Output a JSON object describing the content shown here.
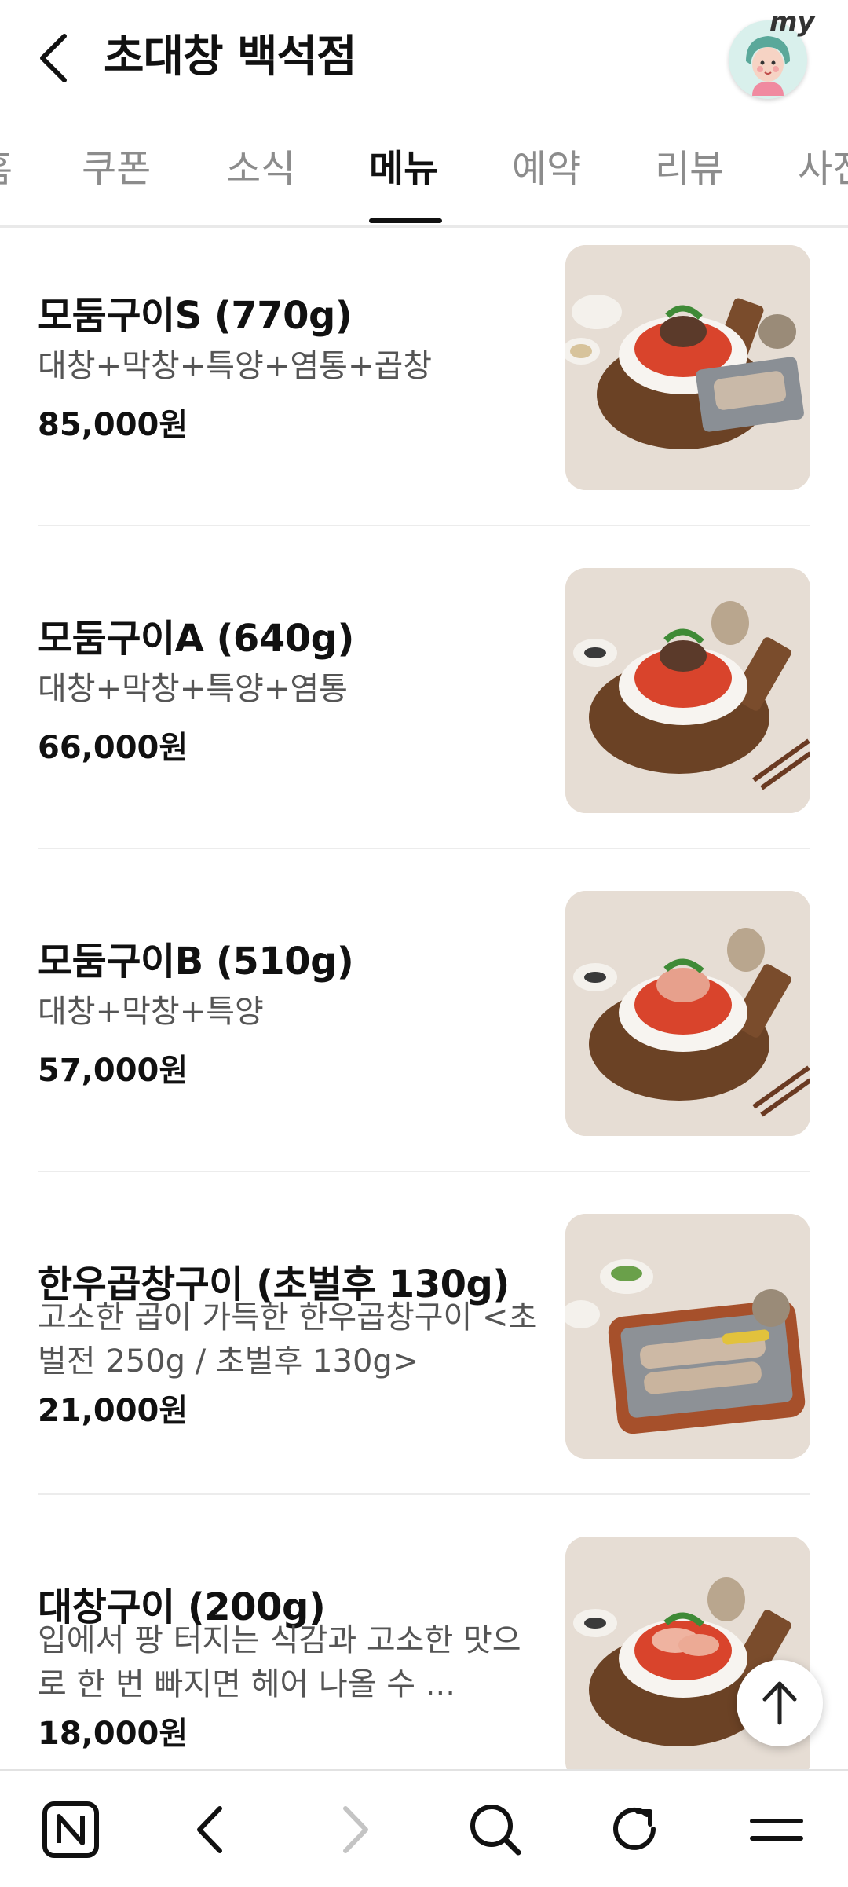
{
  "header": {
    "title": "초대창 백석점",
    "my_label": "my"
  },
  "tabs": [
    {
      "label": "홈"
    },
    {
      "label": "쿠폰"
    },
    {
      "label": "소식"
    },
    {
      "label": "메뉴",
      "active": true
    },
    {
      "label": "예약"
    },
    {
      "label": "리뷰"
    },
    {
      "label": "사진"
    }
  ],
  "menu": [
    {
      "name": "모둠구이S (770g)",
      "desc": "대창+막창+특양+염통+곱창",
      "price": "85,000원"
    },
    {
      "name": "모둠구이A (640g)",
      "desc": "대창+막창+특양+염통",
      "price": "66,000원"
    },
    {
      "name": "모둠구이B (510g)",
      "desc": "대창+막창+특양",
      "price": "57,000원"
    },
    {
      "name": "한우곱창구이 (초벌후 130g)",
      "desc": "고소한 곱이 가득한 한우곱창구이 <초벌전 250g / 초벌후 130g>",
      "price": "21,000원"
    },
    {
      "name": "대창구이 (200g)",
      "desc": "입에서 팡 터지는 식감과 고소한 맛으로 한 번 빠지면 헤어 나올 수 ...",
      "price": "18,000원"
    }
  ],
  "icons": {
    "back": "chevron-left-icon",
    "scroll_top": "arrow-up-icon",
    "nav": [
      "naver-n-icon",
      "back-icon",
      "forward-icon",
      "search-icon",
      "refresh-icon",
      "menu-icon"
    ]
  },
  "colors": {
    "active_tab": "#111111",
    "inactive_tab": "#8c8c8c",
    "forward_disabled": "#c4c4c4"
  }
}
